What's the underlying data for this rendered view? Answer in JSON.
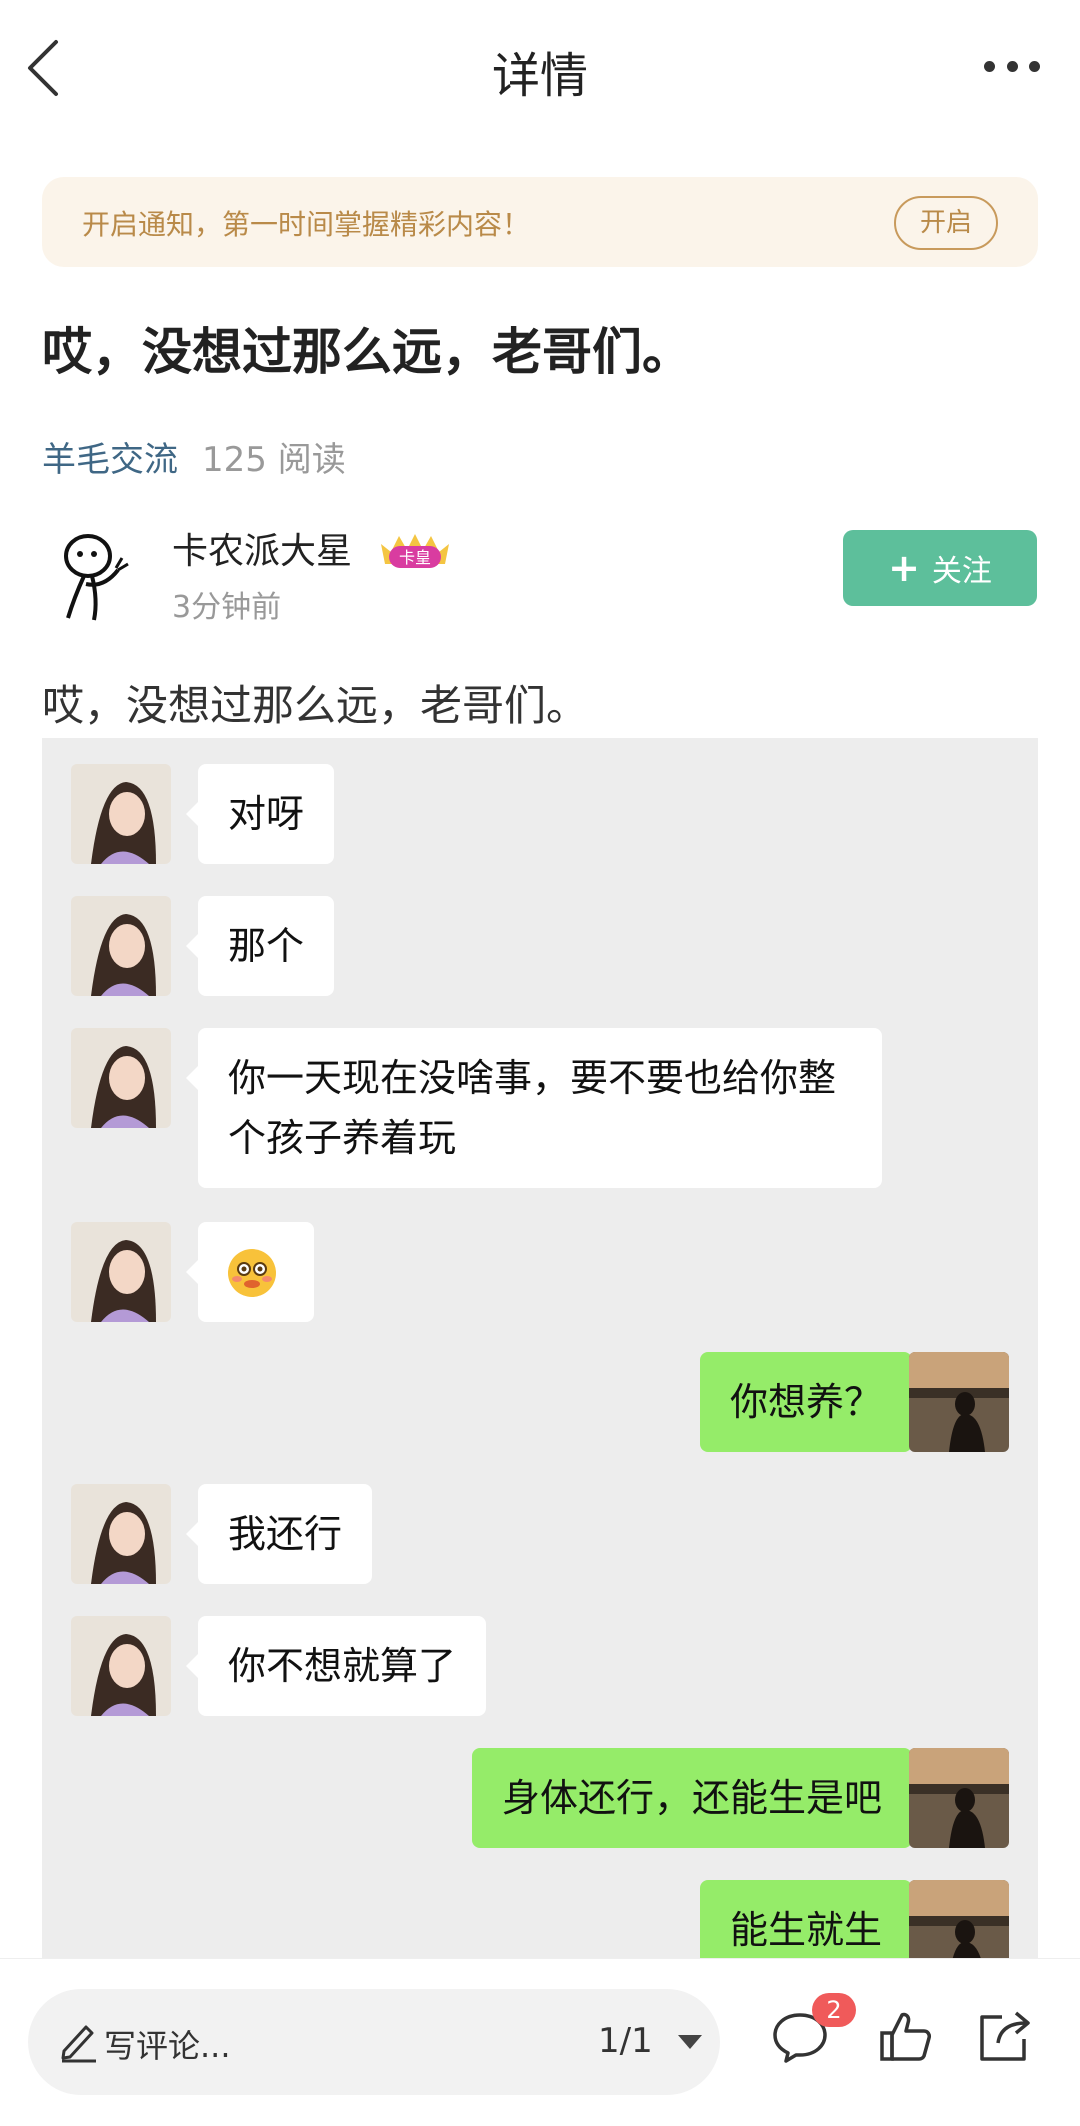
{
  "header": {
    "title": "详情"
  },
  "notice": {
    "text": "开启通知，第一时间掌握精彩内容！",
    "button": "开启"
  },
  "post": {
    "title": "哎，没想过那么远，老哥们。",
    "category": "羊毛交流",
    "reads": "125 阅读",
    "body": "哎，没想过那么远，老哥们。"
  },
  "author": {
    "name": "卡农派大星",
    "badge": "卡皇",
    "time": "3分钟前",
    "follow_label": "关注"
  },
  "chat": {
    "messages": [
      {
        "side": "left",
        "text": "对呀"
      },
      {
        "side": "left",
        "text": "那个"
      },
      {
        "side": "left",
        "text": "你一天现在没啥事，要不要也给你整个孩子养着玩"
      },
      {
        "side": "left",
        "text": "",
        "emoji": "flushed-emoji"
      },
      {
        "side": "right",
        "text": "你想养？"
      },
      {
        "side": "left",
        "text": "我还行"
      },
      {
        "side": "left",
        "text": "你不想就算了"
      },
      {
        "side": "right",
        "text": "身体还行，还能生是吧"
      },
      {
        "side": "right",
        "text": "能生就生"
      }
    ]
  },
  "bottom": {
    "comment_placeholder": "写评论...",
    "page": "1/1",
    "comment_count": "2"
  },
  "colors": {
    "follow": "#5dbf9b",
    "category": "#3f6785",
    "notice_bg": "#fbf4ea",
    "notice_text": "#b98a49",
    "bubble_right": "#95ec69",
    "chat_bg": "#ededed",
    "badge_red": "#f05a5a"
  },
  "icons": [
    "back-arrow-icon",
    "more-dots-icon",
    "crown-badge-icon",
    "plus-icon",
    "pen-icon",
    "caret-down-icon",
    "comment-icon",
    "like-icon",
    "share-icon"
  ]
}
